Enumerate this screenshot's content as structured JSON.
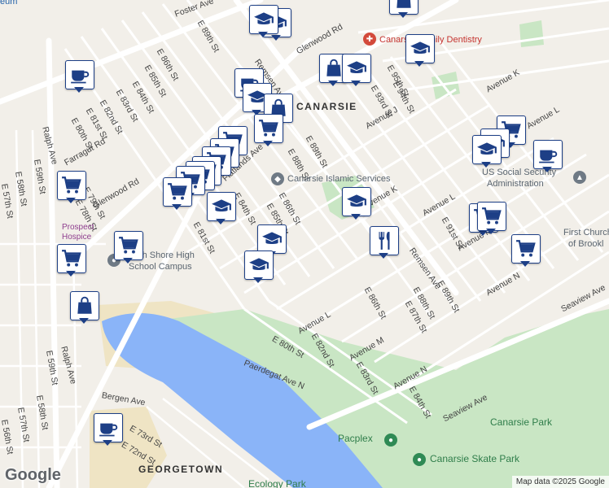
{
  "labels": {
    "neighborhoods": [
      "CANARSIE",
      "GEORGETOWN"
    ],
    "avenues": [
      "Foster Ave",
      "Flatlands Ave",
      "Remsen Ave",
      "Glenwood Rd",
      "Avenue J",
      "Avenue K",
      "Avenue L",
      "Avenue M",
      "Avenue N",
      "Seaview Ave",
      "Farragut Rd",
      "Ralph Ave",
      "Bergen Ave",
      "Paerdegat Ave N",
      "Avenue L"
    ],
    "streets": [
      "E 89th St",
      "E 86th St",
      "E 85th St",
      "E 84th St",
      "E 83rd St",
      "E 82nd St",
      "E 81st St",
      "E 80th St",
      "E 79th St",
      "E 78th St",
      "E 59th St",
      "E 58th St",
      "E 57th St",
      "E 94th St",
      "E 93rd St",
      "E 95th St",
      "E 88th St",
      "E 87th St",
      "E 86th St",
      "E 89th St",
      "E 91st St",
      "E 88th St",
      "E 89th St",
      "E 80th St",
      "E 82nd St",
      "E 83rd St",
      "E 84th St",
      "E 81st St",
      "E 73rd St",
      "E 72nd St",
      "E 56th St",
      "E 57th St",
      "E 58th St",
      "E 59th St",
      "E 85th St",
      "E 86th St"
    ],
    "pois": {
      "dentistry": "Canarsie Family Dentistry",
      "islamic": "Canarsie Islamic Services",
      "ssa_line1": "US Social Security",
      "ssa_line2": "Administration",
      "church_line1": "First Church",
      "church_line2": "of Brookl",
      "hospice_line1": "Prospect",
      "hospice_line2": "Hospice",
      "school_line1": "South Shore High",
      "school_line2": "School Campus",
      "pacplex": "Pacplex",
      "skate": "Canarsie Skate Park",
      "park": "Canarsie Park",
      "ecology": "Ecology Park",
      "museum_fragment": "eum"
    }
  },
  "pins": [
    {
      "icon": "school-icon"
    },
    {
      "icon": "school-icon"
    },
    {
      "icon": "shopping-bag-icon"
    },
    {
      "icon": "school-icon"
    },
    {
      "icon": "school-icon"
    },
    {
      "icon": "shopping-bag-icon"
    },
    {
      "icon": "coffee-icon"
    },
    {
      "icon": "coffee-icon"
    },
    {
      "icon": "school-icon"
    },
    {
      "icon": "shopping-bag-icon"
    },
    {
      "icon": "shopping-cart-icon"
    },
    {
      "icon": "shopping-cart-icon"
    },
    {
      "icon": "shopping-cart-icon"
    },
    {
      "icon": "shopping-cart-icon"
    },
    {
      "icon": "shopping-cart-icon"
    },
    {
      "icon": "shopping-cart-icon"
    },
    {
      "icon": "shopping-cart-icon"
    },
    {
      "icon": "shopping-cart-icon"
    },
    {
      "icon": "shopping-cart-icon"
    },
    {
      "icon": "school-icon"
    },
    {
      "icon": "school-icon"
    },
    {
      "icon": "school-icon"
    },
    {
      "icon": "school-icon"
    },
    {
      "icon": "utensils-icon"
    },
    {
      "icon": "shopping-cart-icon"
    },
    {
      "icon": "shopping-cart-icon"
    },
    {
      "icon": "shopping-cart-icon"
    },
    {
      "icon": "coffee-icon"
    },
    {
      "icon": "school-icon"
    },
    {
      "icon": "school-icon"
    },
    {
      "icon": "shopping-cart-icon"
    },
    {
      "icon": "shopping-cart-icon"
    },
    {
      "icon": "shopping-cart-icon"
    },
    {
      "icon": "shopping-bag-icon"
    },
    {
      "icon": "coffee-icon"
    }
  ],
  "footer": {
    "google": "Google",
    "attribution": "Map data ©2025 Google"
  },
  "colors": {
    "land": "#f2efe9",
    "road": "#ffffff",
    "water": "#8ab4f8",
    "park": "#c9e6c4",
    "sand": "#efe4c4",
    "pin_border": "#1d3f86"
  }
}
